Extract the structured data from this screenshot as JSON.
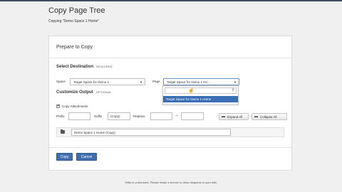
{
  "header": {
    "title": "Copy Page Tree",
    "subtitle": "Copying \"Demo Space 1 Home\""
  },
  "panel": {
    "title": "Prepare to Copy",
    "destination": {
      "label": "Select Destination",
      "tag": "REQUIRED",
      "space_label": "Space",
      "space_value": "Target Space for Demo 1",
      "page_label": "Page",
      "page_value": "Target Space for Demo 1 Ho...",
      "dropdown_option": "Target Space for Demo 1 Home"
    },
    "customize": {
      "label": "Customize Output",
      "tag": "OPTIONAL",
      "copy_attachments_label": "Copy Attachments",
      "copy_attachments_checked": true,
      "prefix_label": "Prefix",
      "prefix_value": "",
      "suffix_label": "Suffix",
      "suffix_value": "(Copy)",
      "replace_label": "Replace",
      "replace_from": "",
      "replace_arrow": "→",
      "replace_to": "",
      "expand_all_label": "Expand All",
      "collapse_all_label": "Collapse All"
    },
    "tree": {
      "root_value": "Demo Space 1 Home (Copy)"
    },
    "actions": {
      "copy_label": "Copy",
      "cancel_label": "Cancel"
    }
  },
  "footer": {
    "notice": "Gliffy is unlicensed. Please install a license to draw diagrams in your wiki."
  },
  "colors": {
    "primary": "#3f6fae",
    "highlight": "#3a6eb5",
    "topbar": "#3b4a5d"
  }
}
